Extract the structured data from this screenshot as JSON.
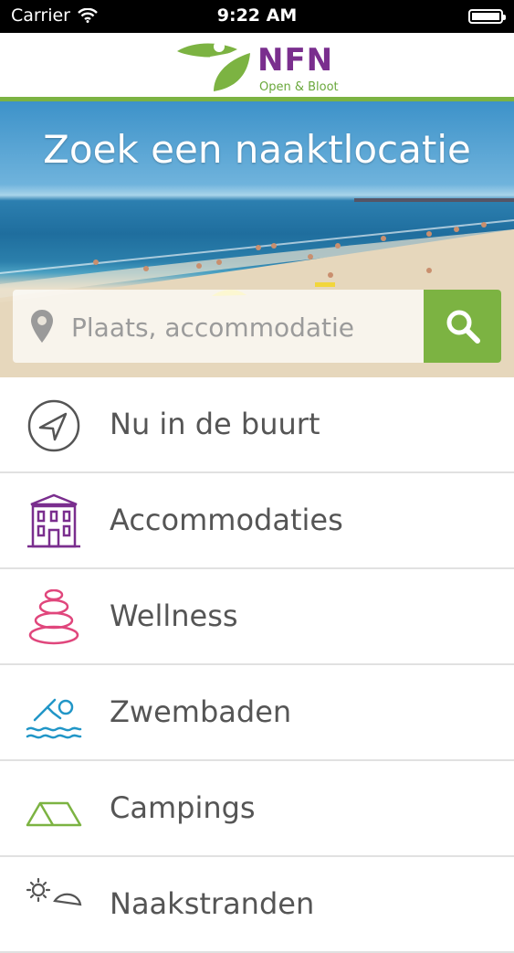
{
  "status_bar": {
    "carrier": "Carrier",
    "time": "9:22 AM",
    "battery_level": 1.0
  },
  "header": {
    "logo_title": "NFN",
    "logo_subtitle": "Open & Bloot",
    "accent_purple": "#7a2e8e",
    "accent_green": "#7cb342"
  },
  "hero": {
    "title": "Zoek een naaktlocatie"
  },
  "search": {
    "placeholder": "Plaats, accommodatie",
    "value": ""
  },
  "menu": {
    "items": [
      {
        "label": "Nu in de buurt",
        "icon": "navigation-arrow-icon",
        "color": "#555555"
      },
      {
        "label": "Accommodaties",
        "icon": "building-icon",
        "color": "#7a2e8e"
      },
      {
        "label": "Wellness",
        "icon": "stones-icon",
        "color": "#e0467c"
      },
      {
        "label": "Zwembaden",
        "icon": "swimmer-icon",
        "color": "#2196c7"
      },
      {
        "label": "Campings",
        "icon": "tent-icon",
        "color": "#7cb342"
      },
      {
        "label": "Naakstranden",
        "icon": "sun-beach-icon",
        "color": "#555555"
      }
    ]
  }
}
